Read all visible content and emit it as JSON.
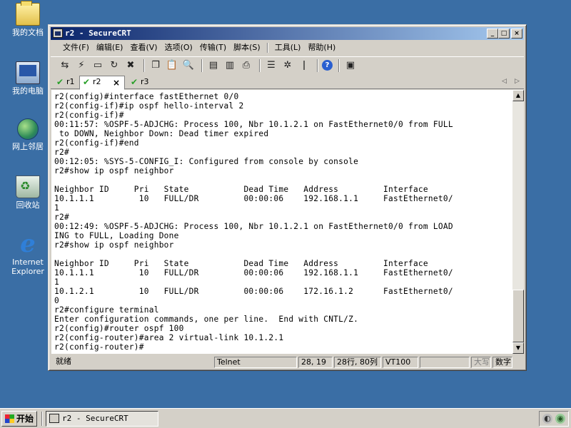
{
  "desktop": {
    "icons": [
      {
        "label": "我的文档",
        "icon": "my-documents-icon"
      },
      {
        "label": "我的电脑",
        "icon": "my-computer-icon"
      },
      {
        "label": "网上邻居",
        "icon": "network-places-icon"
      },
      {
        "label": "回收站",
        "icon": "recycle-bin-icon"
      },
      {
        "label_line1": "Internet",
        "label_line2": "Explorer",
        "icon": "internet-explorer-icon"
      }
    ]
  },
  "window": {
    "title": "r2 - SecureCRT",
    "controls": {
      "minimize": "_",
      "maximize": "□",
      "close": "×"
    },
    "menu": [
      "文件(F)",
      "编辑(E)",
      "查看(V)",
      "选项(O)",
      "传输(T)",
      "脚本(S)",
      "工具(L)",
      "帮助(H)"
    ],
    "tabs": [
      {
        "label": "r1",
        "active": false
      },
      {
        "label": "r2",
        "active": true,
        "close": "×"
      },
      {
        "label": "r3",
        "active": false
      }
    ],
    "tab_nav": {
      "left": "◁",
      "right": "▷"
    },
    "terminal_lines": [
      "r2(config)#interface fastEthernet 0/0",
      "r2(config-if)#ip ospf hello-interval 2",
      "r2(config-if)#",
      "00:11:57: %OSPF-5-ADJCHG: Process 100, Nbr 10.1.2.1 on FastEthernet0/0 from FULL",
      " to DOWN, Neighbor Down: Dead timer expired",
      "r2(config-if)#end",
      "r2#",
      "00:12:05: %SYS-5-CONFIG_I: Configured from console by console",
      "r2#show ip ospf neighbor",
      "",
      "Neighbor ID     Pri   State           Dead Time   Address         Interface",
      "10.1.1.1         10   FULL/DR         00:00:06    192.168.1.1     FastEthernet0/",
      "1",
      "r2#",
      "00:12:49: %OSPF-5-ADJCHG: Process 100, Nbr 10.1.2.1 on FastEthernet0/0 from LOAD",
      "ING to FULL, Loading Done",
      "r2#show ip ospf neighbor",
      "",
      "Neighbor ID     Pri   State           Dead Time   Address         Interface",
      "10.1.1.1         10   FULL/DR         00:00:06    192.168.1.1     FastEthernet0/",
      "1",
      "10.1.2.1         10   FULL/DR         00:00:06    172.16.1.2      FastEthernet0/",
      "0",
      "r2#configure terminal",
      "Enter configuration commands, one per line.  End with CNTL/Z.",
      "r2(config)#router ospf 100",
      "r2(config-router)#area 2 virtual-link 10.1.2.1",
      "r2(config-router)#"
    ],
    "status": {
      "ready": "就绪",
      "protocol": "Telnet",
      "cursor": "28, 19",
      "size": "28行, 80列",
      "emulation": "VT100",
      "caps": "大写",
      "num": "数字"
    }
  },
  "taskbar": {
    "start": "开始",
    "task_title": "r2 - SecureCRT"
  }
}
